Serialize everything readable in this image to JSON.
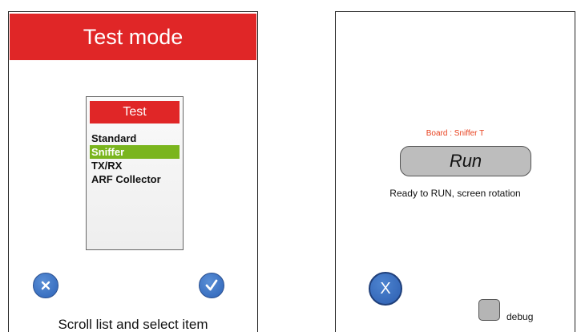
{
  "left_screen": {
    "title": "Test mode",
    "list": {
      "header": "Test",
      "items": [
        "Standard",
        "Sniffer",
        "TX/RX",
        "ARF Collector"
      ],
      "selected_index": 1,
      "selected_color": "#7ab51d"
    },
    "cancel_icon": "x-icon",
    "confirm_icon": "check-icon",
    "instruction": "Scroll list and select item"
  },
  "right_screen": {
    "board_label": "Board : Sniffer T",
    "run_label": "Run",
    "status": "Ready to RUN, screen rotation",
    "cancel_label": "X",
    "debug_label": "debug",
    "debug_checked": false
  },
  "colors": {
    "accent_red": "#e02627",
    "button_blue": "#2d63b8",
    "board_label": "#e8411e"
  }
}
